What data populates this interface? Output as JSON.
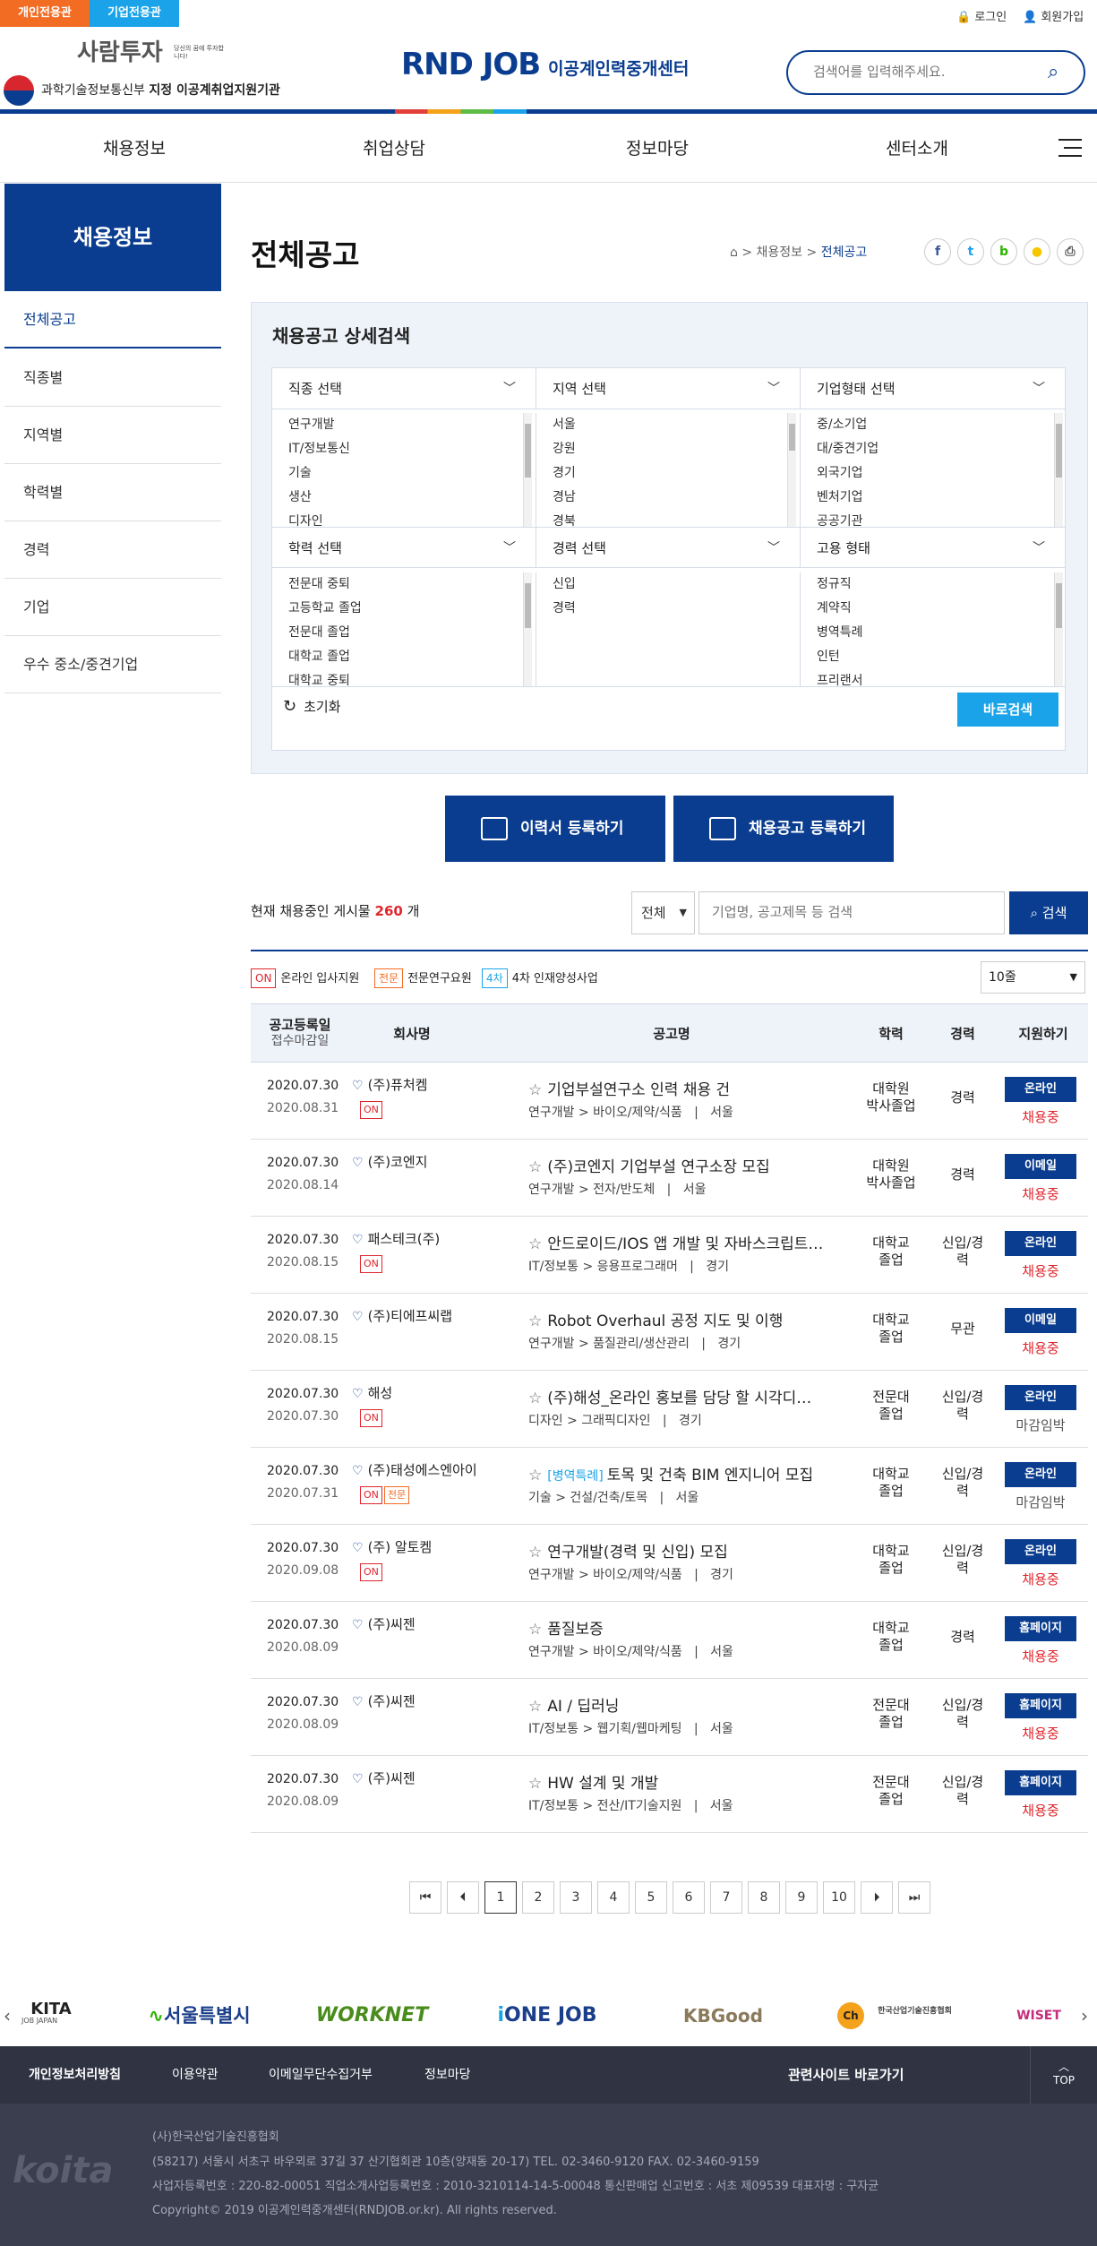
{
  "top": {
    "tab_personal": "개인전용관",
    "tab_company": "기업전용관",
    "login": "로그인",
    "join": "회원가입"
  },
  "header": {
    "saramtuja": "사람투자",
    "saramtuja_sub": "당신의 꿈에 투자합니다!",
    "ministry": "과학기술정보통신부",
    "ministry_sub": "지정 이공계취업지원기관",
    "logo_main": "RND JOB",
    "logo_sub": "이공계인력중개센터",
    "search_placeholder": "검색어를 입력해주세요."
  },
  "gnb": [
    "채용정보",
    "취업상담",
    "정보마당",
    "센터소개"
  ],
  "lnb": {
    "title": "채용정보",
    "items": [
      "전체공고",
      "직종별",
      "지역별",
      "학력별",
      "경력",
      "기업",
      "우수 중소/중견기업"
    ]
  },
  "page": {
    "title": "전체공고",
    "crumb1": "채용정보",
    "crumb2": "전체공고"
  },
  "search": {
    "title": "채용공고 상세검색",
    "groups": [
      {
        "head": "직종 선택",
        "options": [
          "연구개발",
          "IT/정보통신",
          "기술",
          "생산",
          "디자인"
        ]
      },
      {
        "head": "지역 선택",
        "options": [
          "서울",
          "강원",
          "경기",
          "경남",
          "경북"
        ]
      },
      {
        "head": "기업형태 선택",
        "options": [
          "중/소기업",
          "대/중견기업",
          "외국기업",
          "벤처기업",
          "공공기관"
        ]
      },
      {
        "head": "학력 선택",
        "options": [
          "전문대 중퇴",
          "고등학교 졸업",
          "전문대 졸업",
          "대학교 졸업",
          "대학교 중퇴"
        ]
      },
      {
        "head": "경력 선택",
        "options": [
          "신입",
          "경력"
        ]
      },
      {
        "head": "고용 형태",
        "options": [
          "정규직",
          "계약직",
          "병역특례",
          "인턴",
          "프리랜서"
        ]
      }
    ],
    "reset": "초기화",
    "submit": "바로검색"
  },
  "actions": {
    "resume": "이력서 등록하기",
    "post": "채용공고 등록하기"
  },
  "list": {
    "count_prefix": "현재 채용중인 게시물",
    "count": "260",
    "count_suffix": "개",
    "filter": "전체",
    "keyword_placeholder": "기업명, 공고제목 등 검색",
    "search_btn": "검색",
    "legend": [
      {
        "tag": "ON",
        "text": "온라인 입사지원"
      },
      {
        "tag": "전문",
        "text": "전문연구요원"
      },
      {
        "tag": "4차",
        "text": "4차 인재양성사업"
      }
    ],
    "rows_per_page": "10줄",
    "headers": {
      "date1": "공고등록일",
      "date2": "접수마감일",
      "company": "회사명",
      "title": "공고명",
      "edu": "학력",
      "career": "경력",
      "apply": "지원하기"
    },
    "rows": [
      {
        "reg": "2020.07.30",
        "end": "2020.08.31",
        "company": "(주)퓨처켐",
        "tags": [
          "ON"
        ],
        "special": "",
        "title": "기업부설연구소 인력 채용 건",
        "field": "연구개발 > 바이오/제약/식품",
        "region": "서울",
        "edu": [
          "대학원",
          "박사졸업"
        ],
        "career": [
          "경력"
        ],
        "apply": "온라인",
        "status": "채용중"
      },
      {
        "reg": "2020.07.30",
        "end": "2020.08.14",
        "company": "(주)코엔지",
        "tags": [],
        "special": "",
        "title": "(주)코엔지 기업부설 연구소장 모집",
        "field": "연구개발 > 전자/반도체",
        "region": "서울",
        "edu": [
          "대학원",
          "박사졸업"
        ],
        "career": [
          "경력"
        ],
        "apply": "이메일",
        "status": "채용중"
      },
      {
        "reg": "2020.07.30",
        "end": "2020.08.15",
        "company": "패스테크(주)",
        "tags": [
          "ON"
        ],
        "special": "",
        "title": "안드로이드/IOS 앱 개발 및 자바스크립트…",
        "field": "IT/정보통 > 응용프로그래머",
        "region": "경기",
        "edu": [
          "대학교",
          "졸업"
        ],
        "career": [
          "신입/경",
          "력"
        ],
        "apply": "온라인",
        "status": "채용중"
      },
      {
        "reg": "2020.07.30",
        "end": "2020.08.15",
        "company": "(주)티에프씨랩",
        "tags": [],
        "special": "",
        "title": "Robot Overhaul 공정 지도 및 이행",
        "field": "연구개발 > 품질관리/생산관리",
        "region": "경기",
        "edu": [
          "대학교",
          "졸업"
        ],
        "career": [
          "무관"
        ],
        "apply": "이메일",
        "status": "채용중"
      },
      {
        "reg": "2020.07.30",
        "end": "2020.07.30",
        "company": "해성",
        "tags": [
          "ON"
        ],
        "special": "",
        "title": "(주)해성_온라인 홍보를 담당 할 시각디…",
        "field": "디자인 > 그래픽디자인",
        "region": "경기",
        "edu": [
          "전문대",
          "졸업"
        ],
        "career": [
          "신입/경",
          "력"
        ],
        "apply": "온라인",
        "status": "마감임박"
      },
      {
        "reg": "2020.07.30",
        "end": "2020.07.31",
        "company": "(주)태성에스엔아이",
        "tags": [
          "ON",
          "전문"
        ],
        "special": "[병역특례]",
        "title": "토목 및 건축 BIM 엔지니어 모집",
        "field": "기술 > 건설/건축/토목",
        "region": "서울",
        "edu": [
          "대학교",
          "졸업"
        ],
        "career": [
          "신입/경",
          "력"
        ],
        "apply": "온라인",
        "status": "마감임박"
      },
      {
        "reg": "2020.07.30",
        "end": "2020.09.08",
        "company": "(주) 알토켐",
        "tags": [
          "ON"
        ],
        "special": "",
        "title": "연구개발(경력 및 신입) 모집",
        "field": "연구개발 > 바이오/제약/식품",
        "region": "경기",
        "edu": [
          "대학교",
          "졸업"
        ],
        "career": [
          "신입/경",
          "력"
        ],
        "apply": "온라인",
        "status": "채용중"
      },
      {
        "reg": "2020.07.30",
        "end": "2020.08.09",
        "company": "(주)씨젠",
        "tags": [],
        "special": "",
        "title": "품질보증",
        "field": "연구개발 > 바이오/제약/식품",
        "region": "서울",
        "edu": [
          "대학교",
          "졸업"
        ],
        "career": [
          "경력"
        ],
        "apply": "홈페이지",
        "status": "채용중"
      },
      {
        "reg": "2020.07.30",
        "end": "2020.08.09",
        "company": "(주)씨젠",
        "tags": [],
        "special": "",
        "title": "AI / 딥러닝",
        "field": "IT/정보통 > 웹기획/웹마케팅",
        "region": "서울",
        "edu": [
          "전문대",
          "졸업"
        ],
        "career": [
          "신입/경",
          "력"
        ],
        "apply": "홈페이지",
        "status": "채용중"
      },
      {
        "reg": "2020.07.30",
        "end": "2020.08.09",
        "company": "(주)씨젠",
        "tags": [],
        "special": "",
        "title": "HW 설계 및 개발",
        "field": "IT/정보통 > 전산/IT기술지원",
        "region": "서울",
        "edu": [
          "전문대",
          "졸업"
        ],
        "career": [
          "신입/경",
          "력"
        ],
        "apply": "홈페이지",
        "status": "채용중"
      }
    ],
    "pages": [
      "1",
      "2",
      "3",
      "4",
      "5",
      "6",
      "7",
      "8",
      "9",
      "10"
    ]
  },
  "banners": [
    "KITA",
    "JOB JAPAN",
    "서울특별시",
    "WORKNET",
    "ONE JOB",
    "KBGood Job",
    "한국산업기술진흥협회",
    "WISET"
  ],
  "footer": {
    "links": [
      "개인정보처리방침",
      "이용약관",
      "이메일무단수집거부",
      "정보마당"
    ],
    "related": "관련사이트 바로가기",
    "top": "TOP",
    "org_logo": "koita",
    "lines": [
      "(사)한국산업기술진흥협회",
      "(58217) 서울시 서초구 바우뫼로 37길 37 산기협회관 10층(양재동 20-17)    TEL. 02-3460-9120    FAX. 02-3460-9159",
      "사업자등록번호 : 220-82-00051    직업소개사업등록번호 : 2010-3210114-14-5-00048    통신판매업 신고번호 : 서초 제09539    대표자명 : 구자균",
      "Copyright© 2019 이공계인력중개센터(RNDJOB.or.kr). All rights reserved."
    ]
  },
  "colors": {
    "brand": "#0a3d8f",
    "accent": "#1aa3e8",
    "orange": "#f26c24",
    "red": "#e0262d"
  }
}
